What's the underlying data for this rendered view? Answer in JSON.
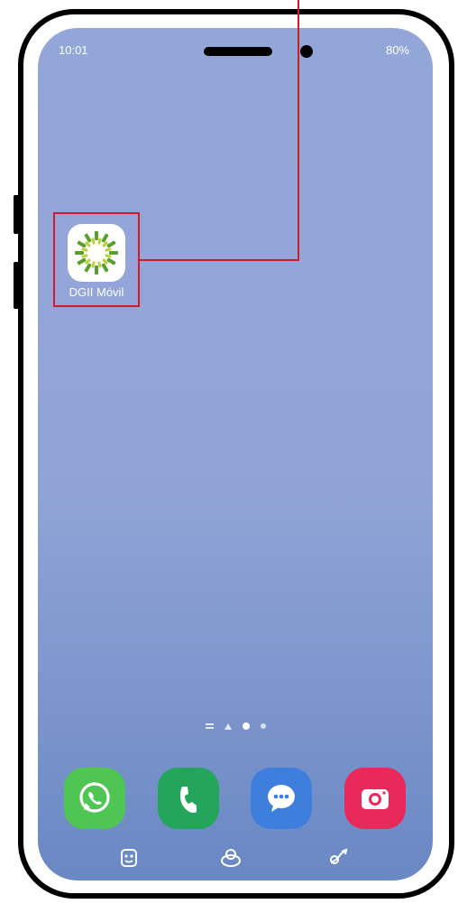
{
  "statusbar": {
    "time": "10:01",
    "battery": "80%"
  },
  "home_apps": [
    {
      "label": "DGII Móvil",
      "icon": "dgii-sun-logo-icon"
    }
  ],
  "page_indicator": {
    "pages": 4,
    "active_index": 2
  },
  "dock": [
    {
      "name": "whatsapp",
      "icon": "whatsapp-icon",
      "color": "#4fc553"
    },
    {
      "name": "phone",
      "icon": "phone-icon",
      "color": "#23a55c"
    },
    {
      "name": "messages",
      "icon": "chat-bubble-icon",
      "color": "#3e7fde"
    },
    {
      "name": "camera",
      "icon": "camera-icon",
      "color": "#e8295a"
    }
  ],
  "navbar": [
    "recent-apps-icon",
    "home-icon",
    "back-icon"
  ],
  "annotation": {
    "color": "#d11a2a"
  },
  "colors": {
    "wallpaper_top": "#93a6d8",
    "wallpaper_bottom": "#6a88c4",
    "dgii_green_dark": "#5a9e2e",
    "dgii_green_light": "#b8d432"
  }
}
